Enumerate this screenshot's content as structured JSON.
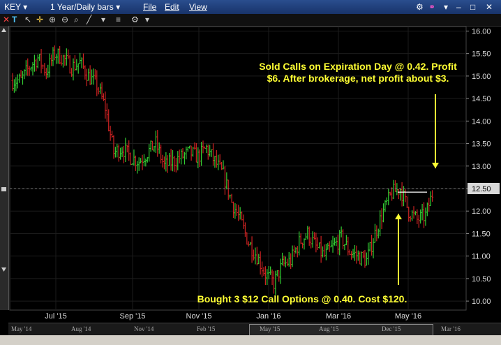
{
  "window": {
    "symbol": "KEY",
    "period": "1 Year/Daily bars",
    "menus": [
      "File",
      "Edit",
      "View"
    ],
    "close_glyph": "✕"
  },
  "toolbar": {
    "icons": [
      "close-icon",
      "text-icon",
      "cursor-icon",
      "crosshair-icon",
      "zoom-in-icon",
      "zoom-out-icon",
      "line-tool-icon",
      "settings-icon",
      "dropdown-icon"
    ]
  },
  "chart_data": {
    "type": "bar",
    "ylim": [
      9.8,
      16.1
    ],
    "yticks": [
      16.0,
      15.5,
      15.0,
      14.5,
      14.0,
      13.5,
      13.0,
      12.5,
      12.0,
      11.5,
      11.0,
      10.5,
      10.0
    ],
    "ytick_labels": [
      "16.00",
      "15.50",
      "15.00",
      "14.50",
      "14.00",
      "13.50",
      "13.00",
      "12.50",
      "12.00",
      "11.50",
      "11.00",
      "10.50",
      "10.00"
    ],
    "xticks": [
      "Jul '15",
      "Sep '15",
      "Nov '15",
      "Jan '16",
      "Mar '16",
      "May '16"
    ],
    "current_price": 12.5,
    "current_price_label": "12.50",
    "up_color": "#33cc33",
    "down_color": "#cc2222",
    "price_path": [
      [
        0,
        14.9
      ],
      [
        5,
        14.9
      ],
      [
        10,
        15.2
      ],
      [
        15,
        15.4
      ],
      [
        20,
        15.1
      ],
      [
        25,
        15.5
      ],
      [
        30,
        15.4
      ],
      [
        35,
        15.2
      ],
      [
        40,
        15.3
      ],
      [
        45,
        15.0
      ],
      [
        50,
        14.8
      ],
      [
        55,
        14.3
      ],
      [
        60,
        13.3
      ],
      [
        65,
        13.4
      ],
      [
        70,
        13.2
      ],
      [
        75,
        13.1
      ],
      [
        80,
        13.3
      ],
      [
        85,
        13.5
      ],
      [
        90,
        13.0
      ],
      [
        95,
        13.1
      ],
      [
        100,
        13.2
      ],
      [
        105,
        13.3
      ],
      [
        110,
        13.2
      ],
      [
        115,
        13.4
      ],
      [
        120,
        13.1
      ],
      [
        125,
        12.8
      ],
      [
        130,
        12.2
      ],
      [
        135,
        11.8
      ],
      [
        140,
        11.3
      ],
      [
        145,
        11.0
      ],
      [
        150,
        10.6
      ],
      [
        155,
        10.4
      ],
      [
        160,
        10.8
      ],
      [
        165,
        10.9
      ],
      [
        170,
        11.3
      ],
      [
        175,
        11.5
      ],
      [
        180,
        11.2
      ],
      [
        185,
        11.0
      ],
      [
        190,
        11.2
      ],
      [
        195,
        11.4
      ],
      [
        200,
        11.1
      ],
      [
        205,
        11.0
      ],
      [
        210,
        10.9
      ],
      [
        215,
        11.5
      ],
      [
        220,
        12.0
      ],
      [
        225,
        12.4
      ],
      [
        230,
        12.5
      ],
      [
        235,
        12.0
      ],
      [
        240,
        11.8
      ],
      [
        245,
        11.9
      ],
      [
        250,
        12.5
      ]
    ],
    "annotations": {
      "sold": "Sold Calls on Expiration Day @ 0.42. Profit $6. After brokerage, net profit about $3.",
      "bought": "Bought 3 $12 Call Options @ 0.40. Cost $120."
    }
  },
  "timeline": {
    "labels": [
      "May '14",
      "Aug '14",
      "Nov '14",
      "Feb '15",
      "May '15",
      "Aug '15",
      "Dec '15",
      "Mar '16"
    ]
  }
}
